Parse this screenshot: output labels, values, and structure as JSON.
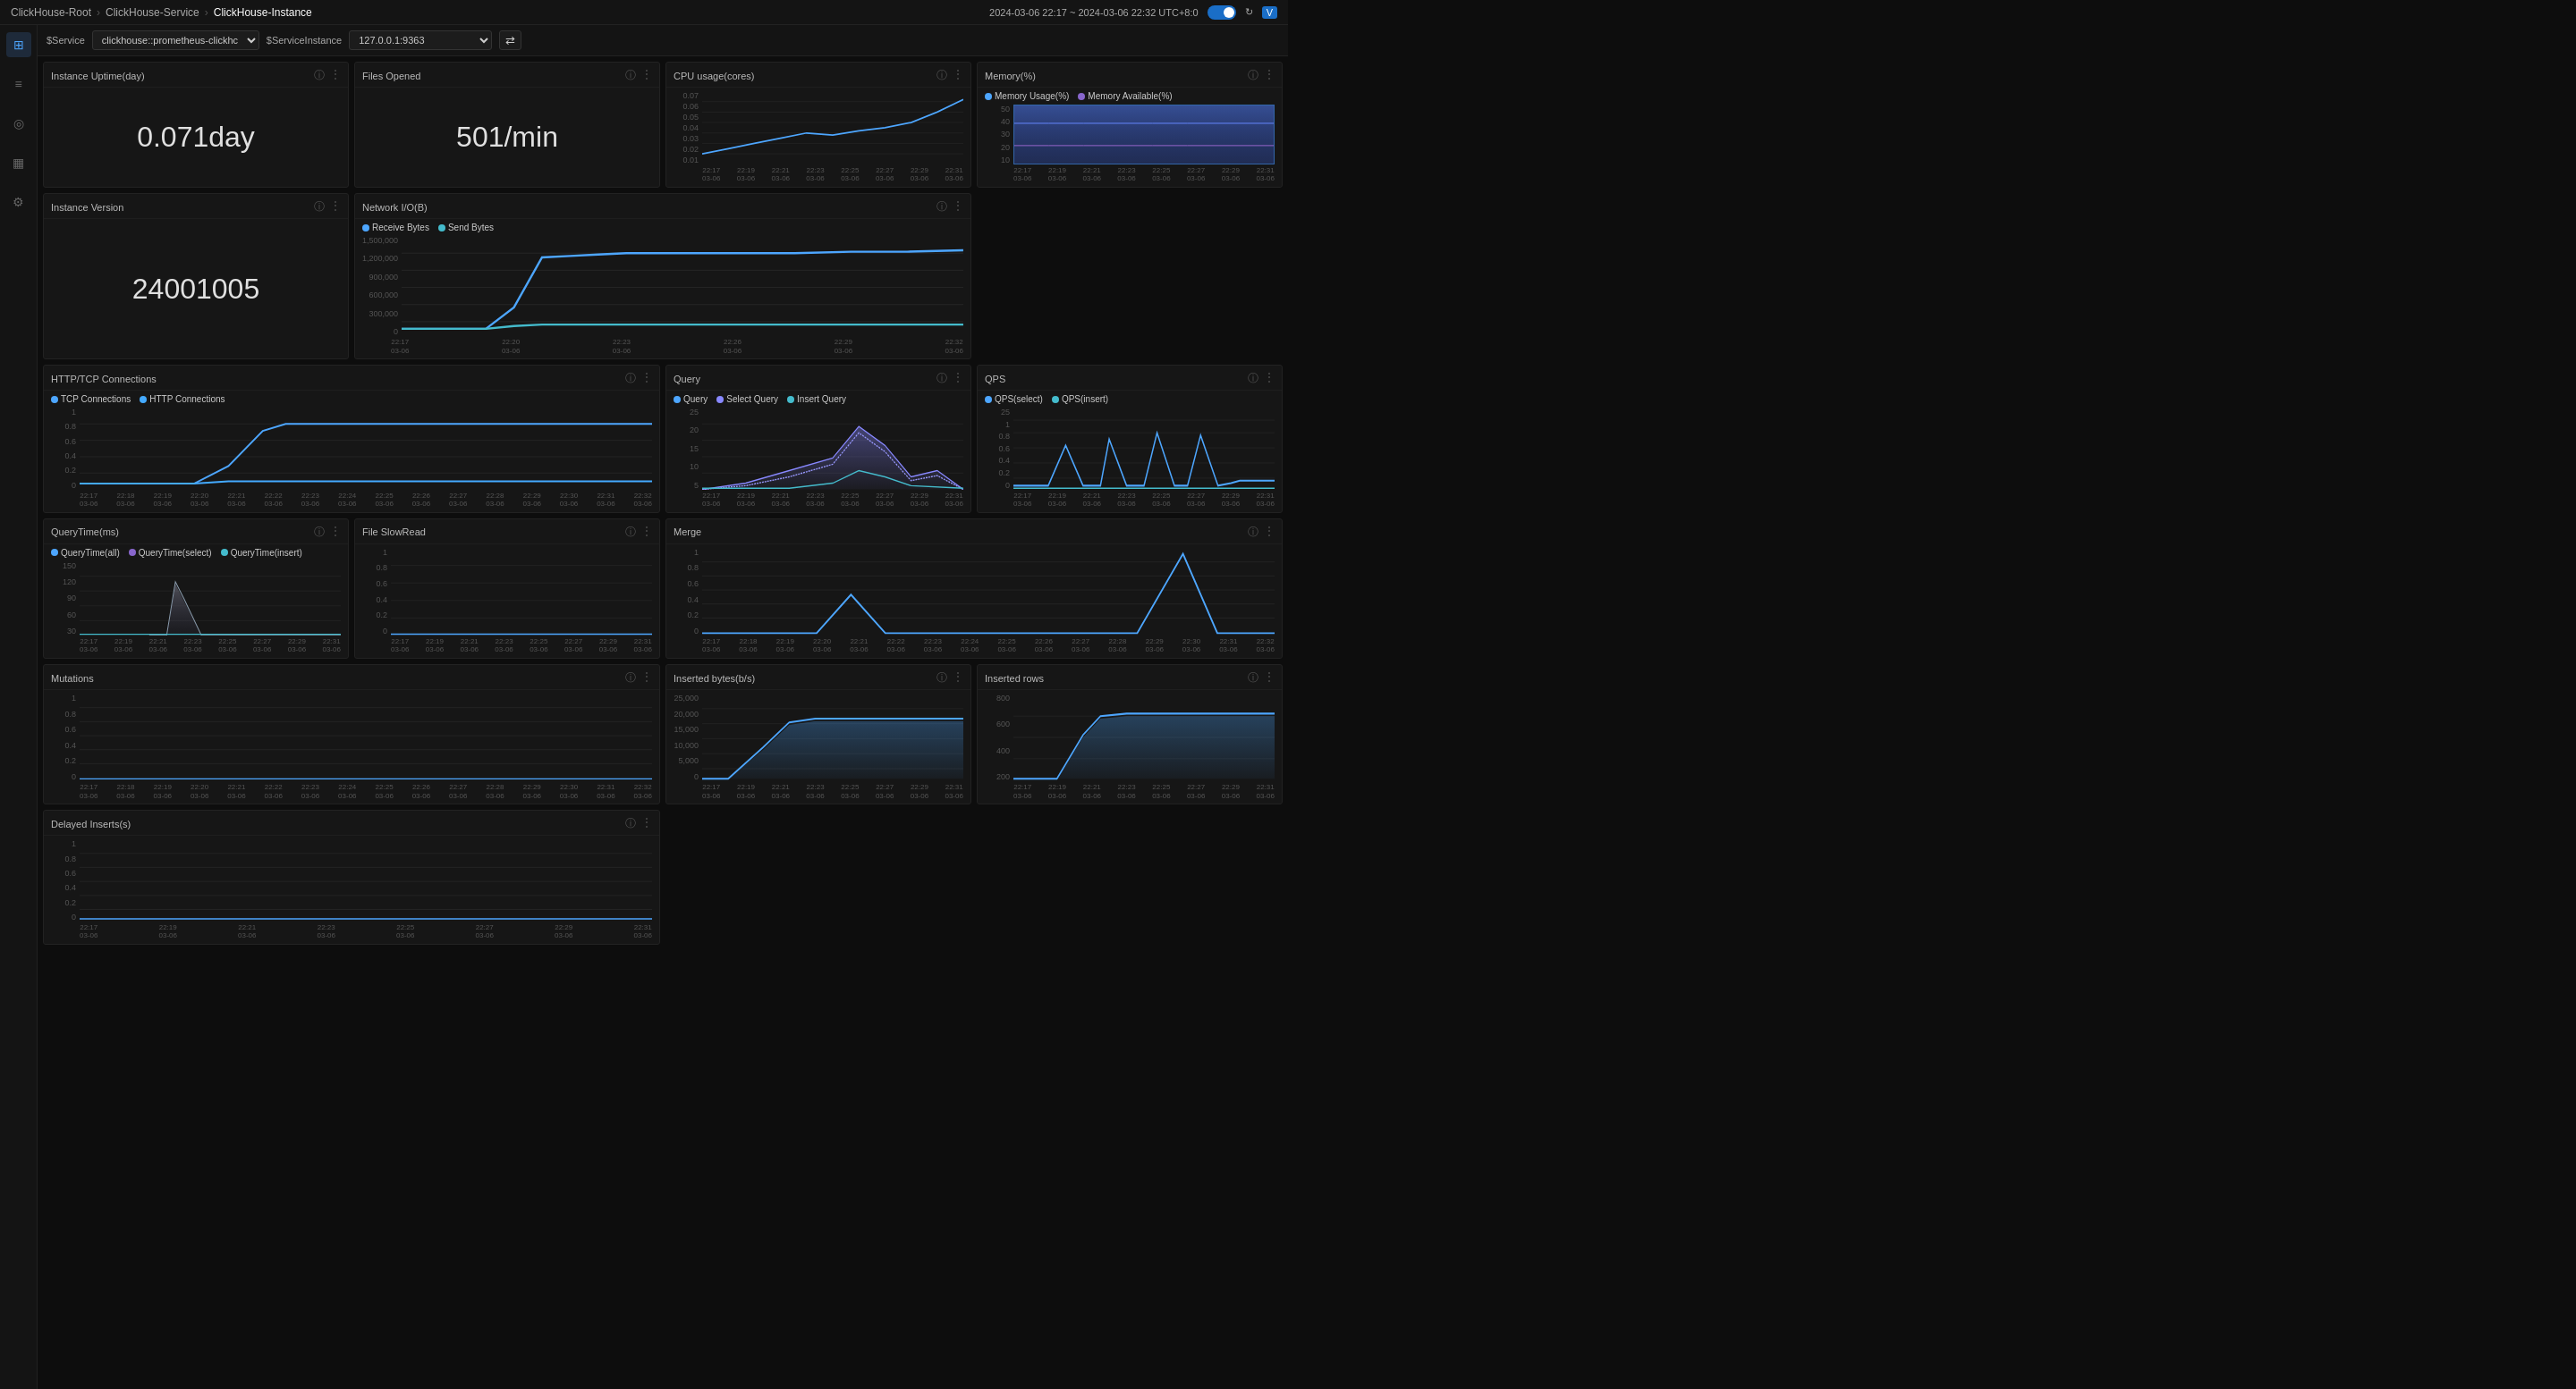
{
  "nav": {
    "breadcrumb": [
      "ClickHouse-Root",
      "ClickHouse-Service",
      "ClickHouse-Instance"
    ],
    "timeRange": "2024-03-06  22:17 ~ 2024-03-06  22:32  UTC+8:0",
    "vBadge": "V"
  },
  "filters": {
    "serviceLabel": "$Service",
    "serviceValue": "clickhouse::prometheus-clickhc",
    "instanceLabel": "$ServiceInstance",
    "instanceValue": "127.0.0.1:9363",
    "syncIcon": "⇄"
  },
  "panels": {
    "uptime": {
      "title": "Instance Uptime(day)",
      "value": "0.071day"
    },
    "filesOpened": {
      "title": "Files Opened",
      "value": "501/min"
    },
    "cpuUsage": {
      "title": "CPU usage(cores)"
    },
    "memory": {
      "title": "Memory(%)",
      "legend": [
        "Memory Usage(%)",
        "Memory Available(%)"
      ],
      "legendColors": [
        "#4da6ff",
        "#8866cc"
      ]
    },
    "instanceVersion": {
      "title": "Instance Version",
      "value": "24001005"
    },
    "networkIO": {
      "title": "Network I/O(B)",
      "legend": [
        "Receive Bytes",
        "Send Bytes"
      ],
      "legendColors": [
        "#4da6ff",
        "#44bbcc"
      ],
      "yLabels": [
        "1,500,000",
        "1,200,000",
        "900,000",
        "600,000",
        "300,000",
        "0"
      ],
      "xLabels": [
        [
          "22:17",
          "03-06"
        ],
        [
          "22:20",
          "03-06"
        ],
        [
          "22:23",
          "03-06"
        ],
        [
          "22:26",
          "03-06"
        ],
        [
          "22:29",
          "03-06"
        ],
        [
          "22:32",
          "03-06"
        ]
      ]
    },
    "httpTcp": {
      "title": "HTTP/TCP Connections",
      "legend": [
        "TCP Connections",
        "HTTP Connections"
      ],
      "legendColors": [
        "#4da6ff",
        "#44aaff"
      ],
      "yLabels": [
        "1",
        "0.8",
        "0.6",
        "0.4",
        "0.2",
        "0"
      ],
      "xLabels": [
        [
          "22:17",
          "03-06"
        ],
        [
          "22:18",
          "03-06"
        ],
        [
          "22:19",
          "03-06"
        ],
        [
          "22:20",
          "03-06"
        ],
        [
          "22:21",
          "03-06"
        ],
        [
          "22:22",
          "03-06"
        ],
        [
          "22:23",
          "03-06"
        ],
        [
          "22:24",
          "03-06"
        ],
        [
          "22:25",
          "03-06"
        ],
        [
          "22:26",
          "03-06"
        ],
        [
          "22:27",
          "03-06"
        ],
        [
          "22:28",
          "03-06"
        ],
        [
          "22:29",
          "03-06"
        ],
        [
          "22:30",
          "03-06"
        ],
        [
          "22:31",
          "03-06"
        ],
        [
          "22:32",
          "03-06"
        ]
      ]
    },
    "query": {
      "title": "Query",
      "legend": [
        "Query",
        "Select Query",
        "Insert Query"
      ],
      "legendColors": [
        "#4da6ff",
        "#8888ff",
        "#44bbcc"
      ],
      "yLabels": [
        "25",
        "20",
        "15",
        "10",
        "5"
      ],
      "xLabels": [
        [
          "22:17",
          "03-06"
        ],
        [
          "22:19",
          "03-06"
        ],
        [
          "22:21",
          "03-06"
        ],
        [
          "22:23",
          "03-06"
        ],
        [
          "22:25",
          "03-06"
        ],
        [
          "22:27",
          "03-06"
        ],
        [
          "22:29",
          "03-06"
        ],
        [
          "22:31",
          "03-06"
        ]
      ]
    },
    "qps": {
      "title": "QPS",
      "legend": [
        "QPS(select)",
        "QPS(insert)"
      ],
      "legendColors": [
        "#4da6ff",
        "#44bbcc"
      ],
      "yLabels": [
        "25",
        "1",
        "0.8",
        "0.6",
        "0.4",
        "0.2",
        "0"
      ],
      "xLabels": [
        [
          "22:17",
          "03-06"
        ],
        [
          "22:19",
          "03-06"
        ],
        [
          "22:21",
          "03-06"
        ],
        [
          "22:23",
          "03-06"
        ],
        [
          "22:25",
          "03-06"
        ],
        [
          "22:27",
          "03-06"
        ],
        [
          "22:29",
          "03-06"
        ],
        [
          "22:31",
          "03-06"
        ]
      ]
    },
    "queryTime": {
      "title": "QueryTime(ms)",
      "legend": [
        "QueryTime(all)",
        "QueryTime(select)",
        "QueryTime(insert)"
      ],
      "legendColors": [
        "#4da6ff",
        "#8866cc",
        "#44bbcc"
      ],
      "yLabels": [
        "150",
        "120",
        "90",
        "60",
        "30"
      ],
      "xLabels": [
        [
          "22:17",
          "03-06"
        ],
        [
          "22:19",
          "03-06"
        ],
        [
          "22:21",
          "03-06"
        ],
        [
          "22:23",
          "03-06"
        ],
        [
          "22:25",
          "03-06"
        ],
        [
          "22:27",
          "03-06"
        ],
        [
          "22:29",
          "03-06"
        ],
        [
          "22:31",
          "03-06"
        ]
      ]
    },
    "fileSlowRead": {
      "title": "File SlowRead",
      "yLabels": [
        "1",
        "0.8",
        "0.6",
        "0.4",
        "0.2",
        "0"
      ],
      "xLabels": [
        [
          "22:17",
          "03-06"
        ],
        [
          "22:19",
          "03-06"
        ],
        [
          "22:21",
          "03-06"
        ],
        [
          "22:23",
          "03-06"
        ],
        [
          "22:25",
          "03-06"
        ],
        [
          "22:27",
          "03-06"
        ],
        [
          "22:29",
          "03-06"
        ],
        [
          "22:31",
          "03-06"
        ]
      ]
    },
    "merge": {
      "title": "Merge",
      "yLabels": [
        "1",
        "0.8",
        "0.6",
        "0.4",
        "0.2",
        "0"
      ],
      "xLabels": [
        [
          "22:17",
          "03-06"
        ],
        [
          "22:18",
          "03-06"
        ],
        [
          "22:19",
          "03-06"
        ],
        [
          "22:20",
          "03-06"
        ],
        [
          "22:21",
          "03-06"
        ],
        [
          "22:22",
          "03-06"
        ],
        [
          "22:23",
          "03-06"
        ],
        [
          "22:24",
          "03-06"
        ],
        [
          "22:25",
          "03-06"
        ],
        [
          "22:26",
          "03-06"
        ],
        [
          "22:27",
          "03-06"
        ],
        [
          "22:28",
          "03-06"
        ],
        [
          "22:29",
          "03-06"
        ],
        [
          "22:30",
          "03-06"
        ],
        [
          "22:31",
          "03-06"
        ],
        [
          "22:32",
          "03-06"
        ]
      ]
    },
    "mutations": {
      "title": "Mutations",
      "yLabels": [
        "1",
        "0.8",
        "0.6",
        "0.4",
        "0.2",
        "0"
      ],
      "xLabels": [
        [
          "22:17",
          "03-06"
        ],
        [
          "22:18",
          "03-06"
        ],
        [
          "22:19",
          "03-06"
        ],
        [
          "22:20",
          "03-06"
        ],
        [
          "22:21",
          "03-06"
        ],
        [
          "22:22",
          "03-06"
        ],
        [
          "22:23",
          "03-06"
        ],
        [
          "22:24",
          "03-06"
        ],
        [
          "22:25",
          "03-06"
        ],
        [
          "22:26",
          "03-06"
        ],
        [
          "22:27",
          "03-06"
        ],
        [
          "22:28",
          "03-06"
        ],
        [
          "22:29",
          "03-06"
        ],
        [
          "22:30",
          "03-06"
        ],
        [
          "22:31",
          "03-06"
        ],
        [
          "22:32",
          "03-06"
        ]
      ]
    },
    "insertedBytes": {
      "title": "Inserted bytes(b/s)",
      "yLabels": [
        "25,000",
        "20,000",
        "15,000",
        "10,000",
        "5,000",
        "0"
      ],
      "xLabels": [
        [
          "22:17",
          "03-06"
        ],
        [
          "22:19",
          "03-06"
        ],
        [
          "22:21",
          "03-06"
        ],
        [
          "22:23",
          "03-06"
        ],
        [
          "22:25",
          "03-06"
        ],
        [
          "22:27",
          "03-06"
        ],
        [
          "22:29",
          "03-06"
        ],
        [
          "22:31",
          "03-06"
        ]
      ]
    },
    "insertedRows": {
      "title": "Inserted rows",
      "yLabels": [
        "800",
        "600",
        "400",
        "200"
      ],
      "xLabels": [
        [
          "22:17",
          "03-06"
        ],
        [
          "22:19",
          "03-06"
        ],
        [
          "22:21",
          "03-06"
        ],
        [
          "22:23",
          "03-06"
        ],
        [
          "22:25",
          "03-06"
        ],
        [
          "22:27",
          "03-06"
        ],
        [
          "22:29",
          "03-06"
        ],
        [
          "22:31",
          "03-06"
        ]
      ]
    },
    "delayedInserts": {
      "title": "Delayed Inserts(s)",
      "yLabels": [
        "1",
        "0.8",
        "0.6",
        "0.4",
        "0.2",
        "0"
      ],
      "xLabels": [
        [
          "22:17",
          "03-06"
        ],
        [
          "22:19",
          "03-06"
        ],
        [
          "22:21",
          "03-06"
        ],
        [
          "22:23",
          "03-06"
        ],
        [
          "22:25",
          "03-06"
        ],
        [
          "22:27",
          "03-06"
        ],
        [
          "22:29",
          "03-06"
        ],
        [
          "22:31",
          "03-06"
        ]
      ]
    }
  },
  "sidebar": {
    "icons": [
      "⊞",
      "≡",
      "◎",
      "▦",
      "⚙"
    ]
  }
}
